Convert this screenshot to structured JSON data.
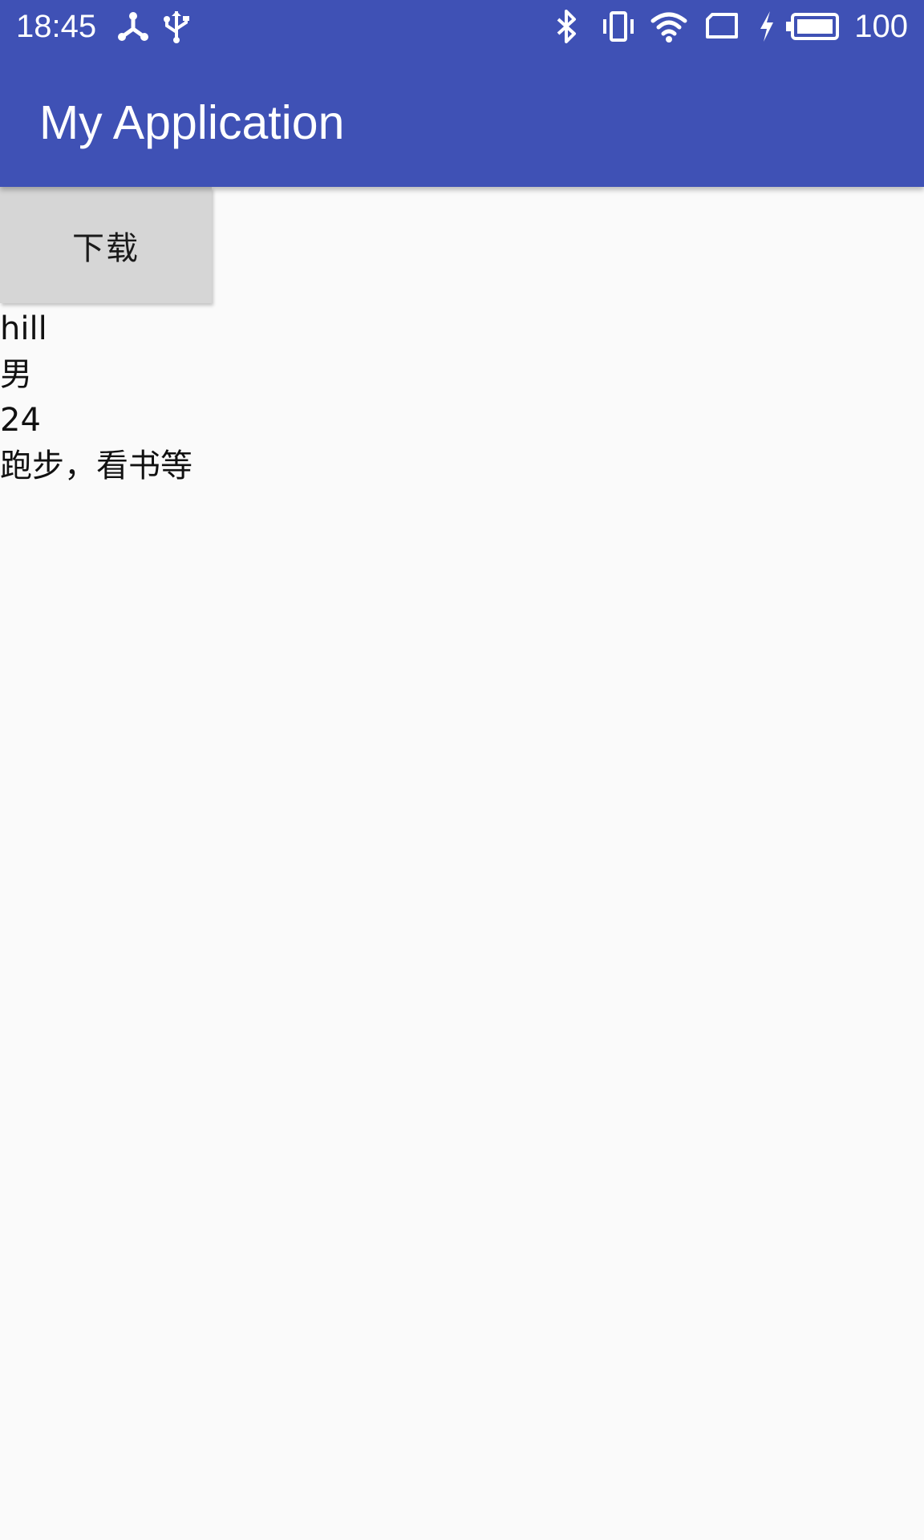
{
  "status_bar": {
    "time": "18:45",
    "battery_level": "100",
    "left_icons": [
      "usb-debug-icon",
      "usb-icon"
    ],
    "right_icons": [
      "bluetooth-icon",
      "vibrate-icon",
      "wifi-icon",
      "no-sim-icon",
      "charging-icon",
      "battery-icon"
    ]
  },
  "app_bar": {
    "title": "My Application",
    "color": "#3f51b5"
  },
  "main": {
    "download_button_label": "下载",
    "info_lines": [
      "hill",
      "男",
      "24",
      "跑步，看书等"
    ]
  }
}
